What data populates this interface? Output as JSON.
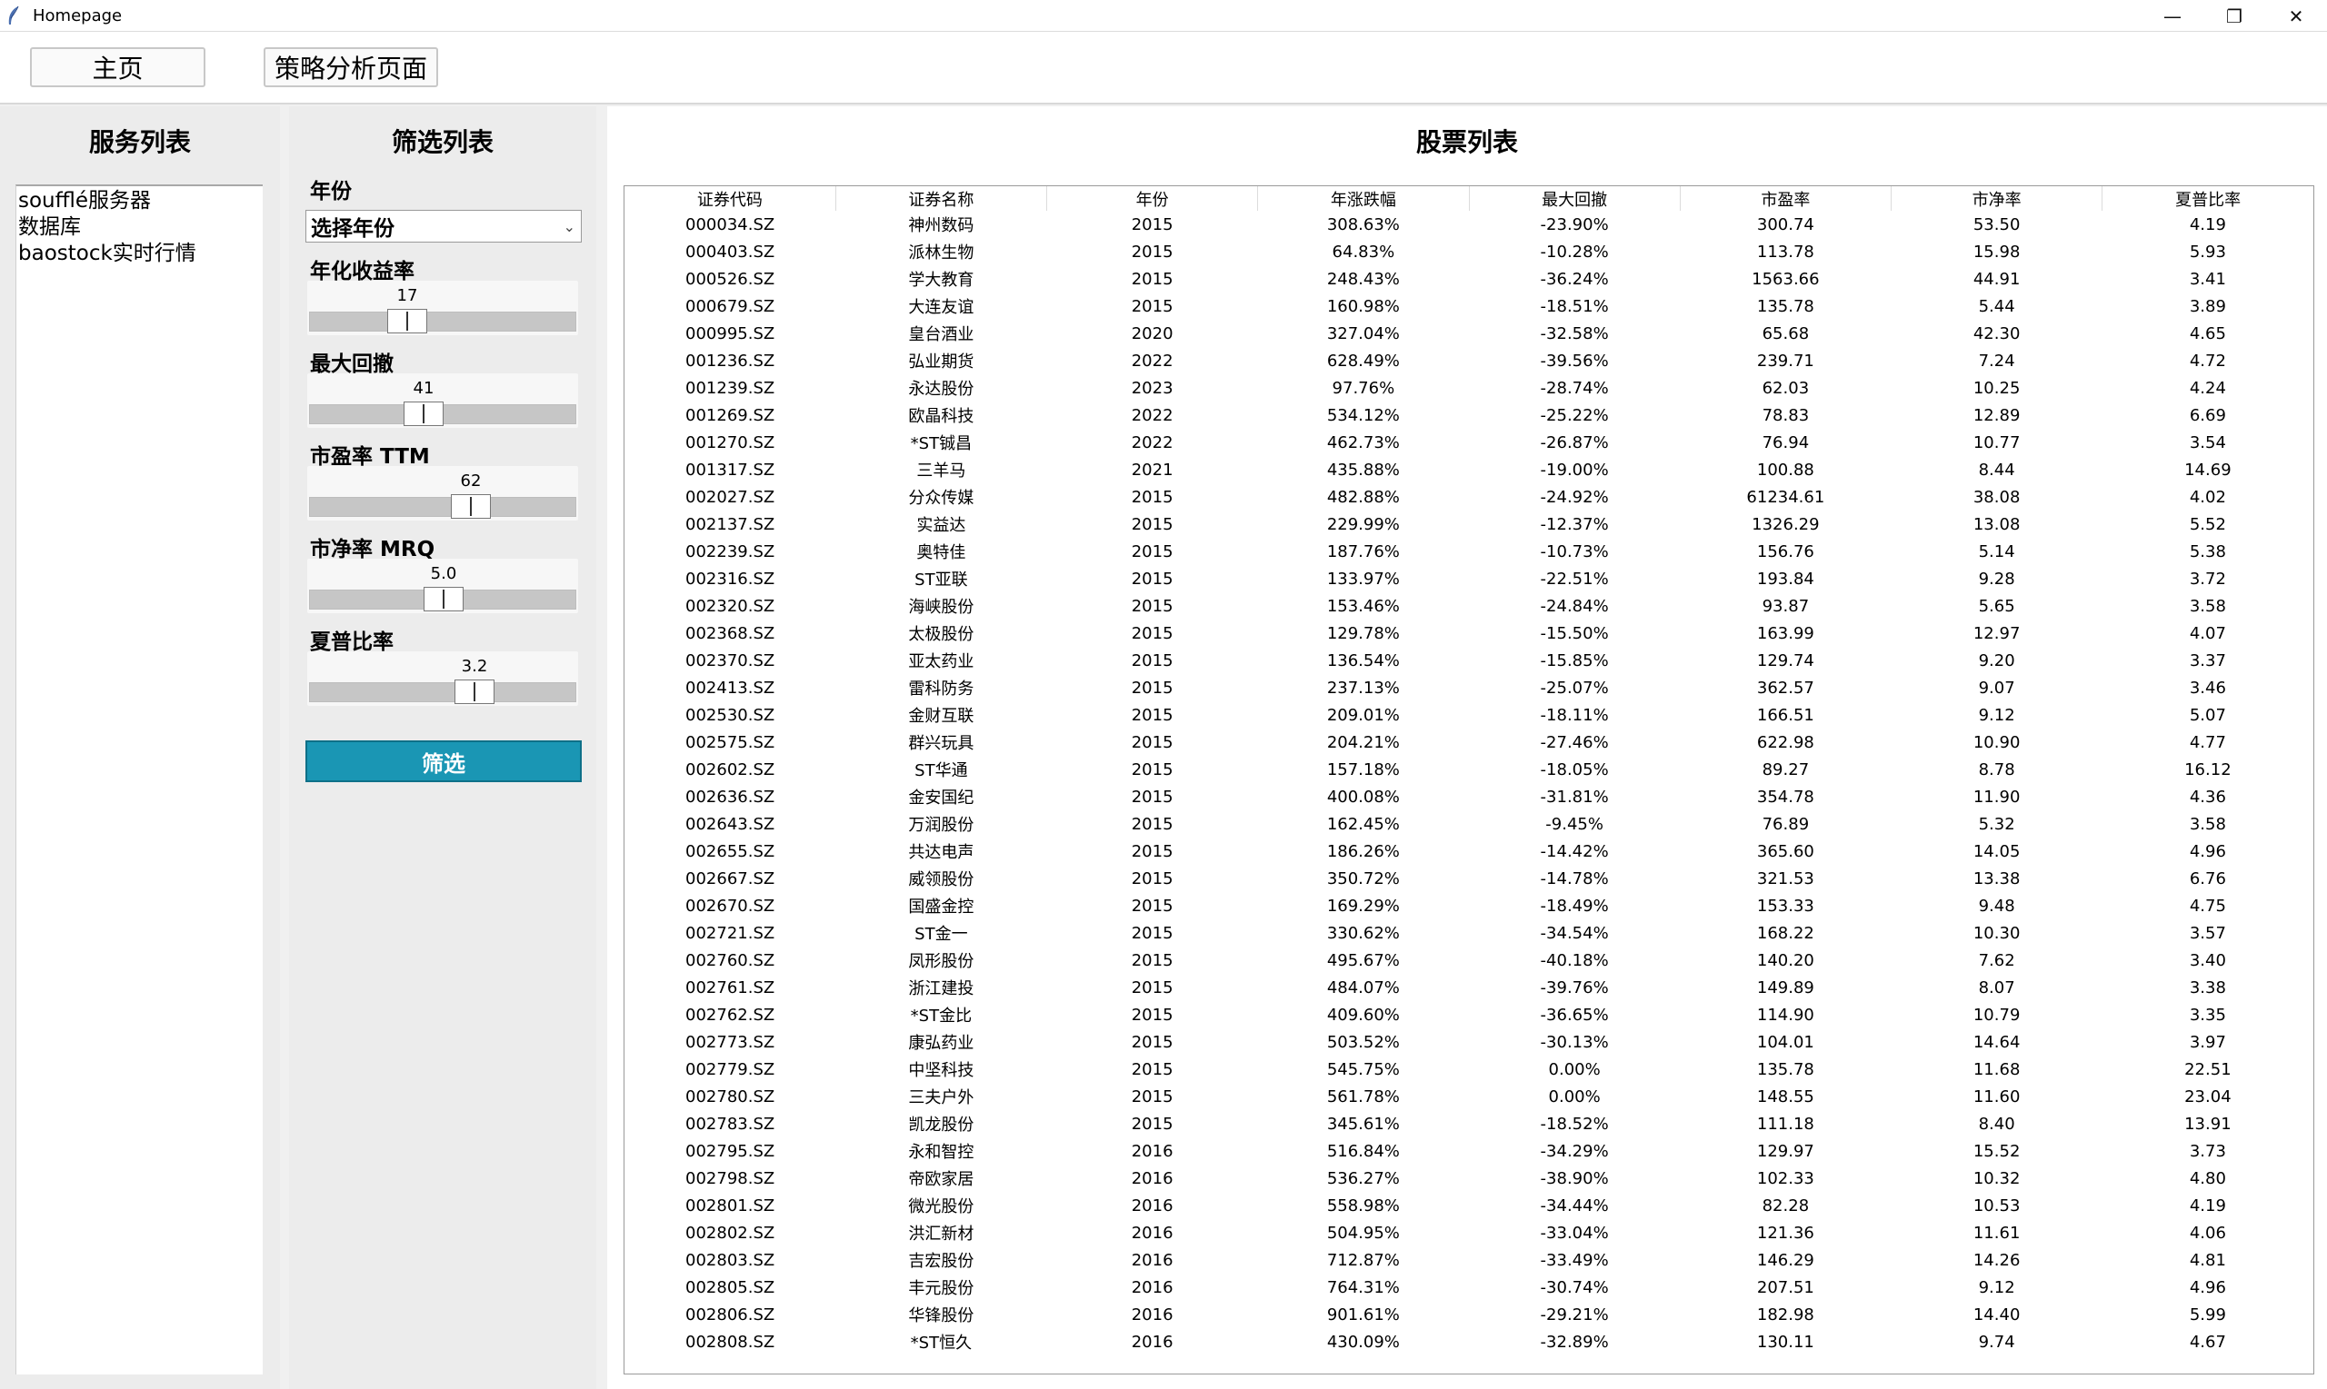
{
  "window": {
    "title": "Homepage",
    "controls": {
      "minimize": "—",
      "maximize": "❐",
      "close": "✕"
    }
  },
  "nav": {
    "home": "主页",
    "strategy": "策略分析页面"
  },
  "services": {
    "title": "服务列表",
    "items": [
      "soufflé服务器",
      "数据库",
      "baostock实时行情"
    ]
  },
  "filters": {
    "title": "筛选列表",
    "year_label": "年份",
    "year_value": "选择年份",
    "annual_return_label": "年化收益率",
    "annual_return_value": "17",
    "max_drawdown_label": "最大回撤",
    "max_drawdown_value": "41",
    "pe_label": "市盈率 TTM",
    "pe_value": "62",
    "pb_label": "市净率 MRQ",
    "pb_value": "5.0",
    "sharpe_label": "夏普比率",
    "sharpe_value": "3.2",
    "submit_label": "筛选"
  },
  "stocks": {
    "title": "股票列表",
    "columns": [
      "证券代码",
      "证券名称",
      "年份",
      "年涨跌幅",
      "最大回撤",
      "市盈率",
      "市净率",
      "夏普比率"
    ],
    "rows": [
      [
        "000034.SZ",
        "神州数码",
        "2015",
        "308.63%",
        "-23.90%",
        "300.74",
        "53.50",
        "4.19"
      ],
      [
        "000403.SZ",
        "派林生物",
        "2015",
        "64.83%",
        "-10.28%",
        "113.78",
        "15.98",
        "5.93"
      ],
      [
        "000526.SZ",
        "学大教育",
        "2015",
        "248.43%",
        "-36.24%",
        "1563.66",
        "44.91",
        "3.41"
      ],
      [
        "000679.SZ",
        "大连友谊",
        "2015",
        "160.98%",
        "-18.51%",
        "135.78",
        "5.44",
        "3.89"
      ],
      [
        "000995.SZ",
        "皇台酒业",
        "2020",
        "327.04%",
        "-32.58%",
        "65.68",
        "42.30",
        "4.65"
      ],
      [
        "001236.SZ",
        "弘业期货",
        "2022",
        "628.49%",
        "-39.56%",
        "239.71",
        "7.24",
        "4.72"
      ],
      [
        "001239.SZ",
        "永达股份",
        "2023",
        "97.76%",
        "-28.74%",
        "62.03",
        "10.25",
        "4.24"
      ],
      [
        "001269.SZ",
        "欧晶科技",
        "2022",
        "534.12%",
        "-25.22%",
        "78.83",
        "12.89",
        "6.69"
      ],
      [
        "001270.SZ",
        "*ST铖昌",
        "2022",
        "462.73%",
        "-26.87%",
        "76.94",
        "10.77",
        "3.54"
      ],
      [
        "001317.SZ",
        "三羊马",
        "2021",
        "435.88%",
        "-19.00%",
        "100.88",
        "8.44",
        "14.69"
      ],
      [
        "002027.SZ",
        "分众传媒",
        "2015",
        "482.88%",
        "-24.92%",
        "61234.61",
        "38.08",
        "4.02"
      ],
      [
        "002137.SZ",
        "实益达",
        "2015",
        "229.99%",
        "-12.37%",
        "1326.29",
        "13.08",
        "5.52"
      ],
      [
        "002239.SZ",
        "奥特佳",
        "2015",
        "187.76%",
        "-10.73%",
        "156.76",
        "5.14",
        "5.38"
      ],
      [
        "002316.SZ",
        "ST亚联",
        "2015",
        "133.97%",
        "-22.51%",
        "193.84",
        "9.28",
        "3.72"
      ],
      [
        "002320.SZ",
        "海峡股份",
        "2015",
        "153.46%",
        "-24.84%",
        "93.87",
        "5.65",
        "3.58"
      ],
      [
        "002368.SZ",
        "太极股份",
        "2015",
        "129.78%",
        "-15.50%",
        "163.99",
        "12.97",
        "4.07"
      ],
      [
        "002370.SZ",
        "亚太药业",
        "2015",
        "136.54%",
        "-15.85%",
        "129.74",
        "9.20",
        "3.37"
      ],
      [
        "002413.SZ",
        "雷科防务",
        "2015",
        "237.13%",
        "-25.07%",
        "362.57",
        "9.07",
        "3.46"
      ],
      [
        "002530.SZ",
        "金财互联",
        "2015",
        "209.01%",
        "-18.11%",
        "166.51",
        "9.12",
        "5.07"
      ],
      [
        "002575.SZ",
        "群兴玩具",
        "2015",
        "204.21%",
        "-27.46%",
        "622.98",
        "10.90",
        "4.77"
      ],
      [
        "002602.SZ",
        "ST华通",
        "2015",
        "157.18%",
        "-18.05%",
        "89.27",
        "8.78",
        "16.12"
      ],
      [
        "002636.SZ",
        "金安国纪",
        "2015",
        "400.08%",
        "-31.81%",
        "354.78",
        "11.90",
        "4.36"
      ],
      [
        "002643.SZ",
        "万润股份",
        "2015",
        "162.45%",
        "-9.45%",
        "76.89",
        "5.32",
        "3.58"
      ],
      [
        "002655.SZ",
        "共达电声",
        "2015",
        "186.26%",
        "-14.42%",
        "365.60",
        "14.05",
        "4.96"
      ],
      [
        "002667.SZ",
        "威领股份",
        "2015",
        "350.72%",
        "-14.78%",
        "321.53",
        "13.38",
        "6.76"
      ],
      [
        "002670.SZ",
        "国盛金控",
        "2015",
        "169.29%",
        "-18.49%",
        "153.33",
        "9.48",
        "4.75"
      ],
      [
        "002721.SZ",
        "ST金一",
        "2015",
        "330.62%",
        "-34.54%",
        "168.22",
        "10.30",
        "3.57"
      ],
      [
        "002760.SZ",
        "凤形股份",
        "2015",
        "495.67%",
        "-40.18%",
        "140.20",
        "7.62",
        "3.40"
      ],
      [
        "002761.SZ",
        "浙江建投",
        "2015",
        "484.07%",
        "-39.76%",
        "149.89",
        "8.07",
        "3.38"
      ],
      [
        "002762.SZ",
        "*ST金比",
        "2015",
        "409.60%",
        "-36.65%",
        "114.90",
        "10.79",
        "3.35"
      ],
      [
        "002773.SZ",
        "康弘药业",
        "2015",
        "503.52%",
        "-30.13%",
        "104.01",
        "14.64",
        "3.97"
      ],
      [
        "002779.SZ",
        "中坚科技",
        "2015",
        "545.75%",
        "0.00%",
        "135.78",
        "11.68",
        "22.51"
      ],
      [
        "002780.SZ",
        "三夫户外",
        "2015",
        "561.78%",
        "0.00%",
        "148.55",
        "11.60",
        "23.04"
      ],
      [
        "002783.SZ",
        "凯龙股份",
        "2015",
        "345.61%",
        "-18.52%",
        "111.18",
        "8.40",
        "13.91"
      ],
      [
        "002795.SZ",
        "永和智控",
        "2016",
        "516.84%",
        "-34.29%",
        "129.97",
        "15.52",
        "3.73"
      ],
      [
        "002798.SZ",
        "帝欧家居",
        "2016",
        "536.27%",
        "-38.90%",
        "102.33",
        "10.32",
        "4.80"
      ],
      [
        "002801.SZ",
        "微光股份",
        "2016",
        "558.98%",
        "-34.44%",
        "82.28",
        "10.53",
        "4.19"
      ],
      [
        "002802.SZ",
        "洪汇新材",
        "2016",
        "504.95%",
        "-33.04%",
        "121.36",
        "11.61",
        "4.06"
      ],
      [
        "002803.SZ",
        "吉宏股份",
        "2016",
        "712.87%",
        "-33.49%",
        "146.29",
        "14.26",
        "4.81"
      ],
      [
        "002805.SZ",
        "丰元股份",
        "2016",
        "764.31%",
        "-30.74%",
        "207.51",
        "9.12",
        "4.96"
      ],
      [
        "002806.SZ",
        "华锋股份",
        "2016",
        "901.61%",
        "-29.21%",
        "182.98",
        "14.40",
        "5.99"
      ],
      [
        "002808.SZ",
        "*ST恒久",
        "2016",
        "430.09%",
        "-32.89%",
        "130.11",
        "9.74",
        "4.67"
      ]
    ]
  }
}
